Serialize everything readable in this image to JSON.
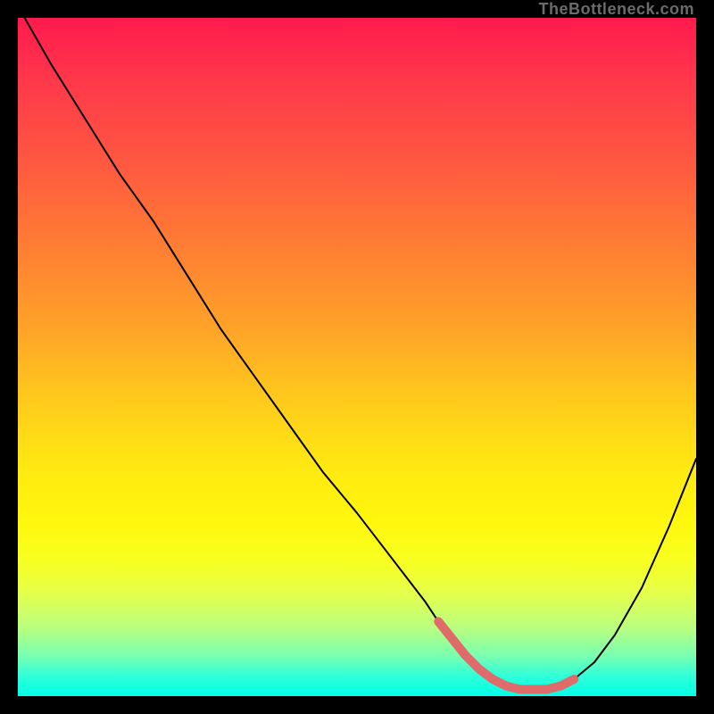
{
  "watermark": "TheBottleneck.com",
  "chart_data": {
    "type": "line",
    "title": "",
    "xlabel": "",
    "ylabel": "",
    "xlim": [
      0,
      100
    ],
    "ylim": [
      0,
      100
    ],
    "grid": false,
    "legend": false,
    "x": [
      1,
      5,
      10,
      15,
      20,
      25,
      30,
      35,
      40,
      45,
      50,
      55,
      60,
      62,
      64,
      66,
      68,
      70,
      72,
      74,
      76,
      78,
      80,
      82,
      85,
      88,
      92,
      96,
      100
    ],
    "values": [
      100,
      93,
      85,
      77,
      70,
      62,
      54,
      47,
      40,
      33,
      27,
      20.5,
      14,
      11,
      8.5,
      6,
      4,
      2.5,
      1.5,
      1,
      1,
      1,
      1.5,
      2.5,
      5,
      9,
      16,
      25,
      35
    ],
    "highlight": {
      "color": "#e06b6b",
      "x": [
        62,
        64,
        66,
        68,
        70,
        72,
        74,
        76,
        78,
        80,
        82
      ],
      "values": [
        11,
        8.5,
        6,
        4,
        2.5,
        1.5,
        1,
        1,
        1,
        1.5,
        2.5
      ]
    }
  }
}
